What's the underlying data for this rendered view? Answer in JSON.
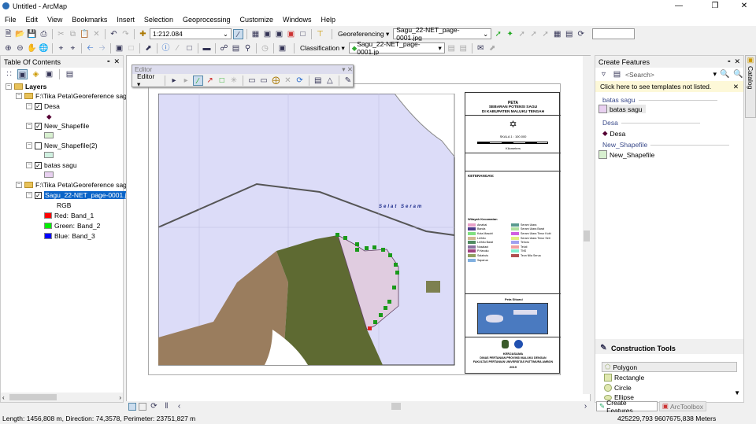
{
  "window": {
    "title": "Untitled - ArcMap"
  },
  "menu": [
    "File",
    "Edit",
    "View",
    "Bookmarks",
    "Insert",
    "Selection",
    "Geoprocessing",
    "Customize",
    "Windows",
    "Help"
  ],
  "toolbar": {
    "scale": "1:212.084",
    "georeferencing_label": "Georeferencing",
    "georef_layer": "Sagu_22-NET_page-0001.jpg",
    "classification_label": "Classification",
    "class_layer": "Sagu_22-NET_page-0001.jp",
    "rotation_value": ""
  },
  "toc": {
    "title": "Table Of Contents",
    "root": "Layers",
    "group1": "F:\\Tika Peta\\Georeference sag",
    "layers": [
      {
        "name": "Desa",
        "checked": true
      },
      {
        "name": "New_Shapefile",
        "checked": true,
        "color": "#d8f0d0"
      },
      {
        "name": "New_Shapefile(2)",
        "checked": false,
        "color": "#d0f0e0"
      },
      {
        "name": "batas sagu",
        "checked": true,
        "color": "#e8d0f0"
      }
    ],
    "group2": "F:\\Tika Peta\\Georeference sag",
    "raster": {
      "name": "Sagu_22-NET_page-0001.jp",
      "rgb": "RGB",
      "bands": [
        {
          "ch": "Red:",
          "band": "Band_1",
          "color": "#ff0000"
        },
        {
          "ch": "Green:",
          "band": "Band_2",
          "color": "#00e000"
        },
        {
          "ch": "Blue:",
          "band": "Band_3",
          "color": "#0000ff"
        }
      ]
    }
  },
  "editor": {
    "title": "Editor",
    "menu": "Editor"
  },
  "map": {
    "sea_label": "Selat Seram",
    "title1": "PETA",
    "title2": "SEBARAN POTENSI SAGU",
    "title3": "DI KABUPATEN MALUKU TENGAH",
    "scale": "SKALA 1 : 100.000",
    "units": "Kilometers",
    "keterangan": "KETERANGAN:",
    "kec_title": "Wilayah Kecamatan",
    "legend_left": [
      "Amahai",
      "Banda",
      "Kota Masohi",
      "Leihitu",
      "Leihitu Barat",
      "Nusalaut",
      "P.Haruku",
      "Salahutu",
      "Saparua"
    ],
    "legend_right": [
      "Seram Utara",
      "Seram Utara Barat",
      "Seram Utara Timur Kobi",
      "Seram Utara Timur Seti",
      "Tehoru",
      "Teluti",
      "TNS",
      "Teon Nila Serua"
    ],
    "situasi": "Peta Situasi",
    "footer1": "KERJASAMA",
    "footer2": "DINAS PERTANIAN PROVINSI MALUKU DENGAN",
    "footer3": "FAKULTAS PERTANIAN UNIVERSITAS PATTIMURA AMBON",
    "footer4": "2019"
  },
  "create_features": {
    "title": "Create Features",
    "search_placeholder": "<Search>",
    "notice": "Click here to see templates not listed.",
    "groups": [
      {
        "name": "batas sagu",
        "item": "batas sagu",
        "color": "#e8d0f0"
      },
      {
        "name": "Desa",
        "item": "Desa"
      },
      {
        "name": "New_Shapefile",
        "item": "New_Shapefile",
        "color": "#d8f0d0"
      }
    ]
  },
  "construction": {
    "title": "Construction Tools",
    "tools": [
      "Polygon",
      "Rectangle",
      "Circle",
      "Ellipse"
    ]
  },
  "tabs": {
    "create": "Create Features",
    "toolbox": "ArcToolbox"
  },
  "catalog": "Catalog",
  "status": {
    "left": "Length: 1456,808 m, Direction: 74,3578, Perimeter: 23751,827 m",
    "right": "425229,793  9607675,838 Meters"
  }
}
